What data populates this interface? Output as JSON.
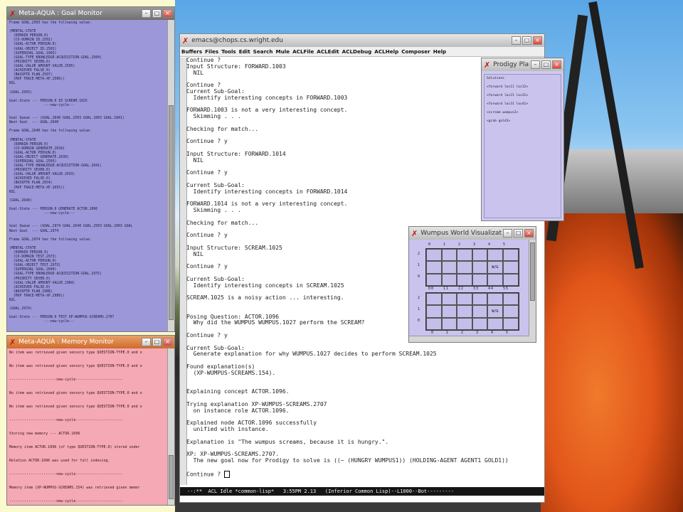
{
  "goal_monitor": {
    "title": "Meta-AQUA : Goal Monitor",
    "lines": [
      "Frame GOAL.2503 has the following value:",
      "",
      "(MENTAL-STATE",
      "  (DOMAIN PERSON.0)",
      "  (CO-DOMAIN ID.2502)",
      "  (GOAL-ACTOR PERSON.0)",
      "  (GOAL-OBJECT ID.2502)",
      "  (SUPERGOAL GOAL.1003)",
      "  (GOAL-TYPE KNOWLEDGE-ACQUISITION-GOAL.2504)",
      "  (PRIORITY SEVEN.0)",
      "  (GOAL-VALUE AMOUNT-VALUE.2505)",
      "  (ACHIEVED FALSE.0)",
      "  (BACKPTR PLAN.2507)",
      "  (MXP TRACE-META-XP.2506))",
      "NIL",
      "",
      "(GOAL.2503)",
      "",
      "Goal-State --- PERSON.0 ID SCREAM.1025",
      "                 ---new-cycle---",
      "",
      "",
      "Goal Queue --- (GOAL.2640 GOAL.2503 GOAL.1003 GOAL.1841)",
      "Next Goal  --- GOAL.2640",
      "",
      "Frame GOAL.2640 has the following value:",
      "",
      "(MENTAL-STATE",
      "  (DOMAIN PERSON.0)",
      "  (CO-DOMAIN GENERATE.2639)",
      "  (GOAL-ACTOR PERSON.0)",
      "  (GOAL-OBJECT GENERATE.2639)",
      "  (SUPERGOAL GOAL.2503)",
      "  (GOAL-TYPE KNOWLEDGE-ACQUISITION-GOAL.2641)",
      "  (PRIORITY SEVEN.0)",
      "  (GOAL-VALUE AMOUNT-VALUE.2633)",
      "  (ACHIEVED FALSE.0)",
      "  (BACKPTR PLAN.2654)",
      "  (MXP TRACE-META-XP.2655))",
      "NIL",
      "",
      "(GOAL.2640)",
      "",
      "Goal-State --- PERSON.0 GENERATE ACTOR.1096",
      "                 ---new-cycle---",
      "",
      "",
      "Goal Queue --- (GOAL.2974 GOAL.2640 GOAL.2503 GOAL.1003 GOAL",
      "Next Goal  --- GOAL.2974",
      "",
      "Frame GOAL.2974 has the following value:",
      "",
      "(MENTAL-STATE",
      "  (DOMAIN PERSON.0)",
      "  (CO-DOMAIN TEST.2973)",
      "  (GOAL-ACTOR PERSON.0)",
      "  (GOAL-OBJECT TEST.2973)",
      "  (SUPERGOAL GOAL.2640)",
      "  (GOAL-TYPE KNOWLEDGE-ACQUISITION-GOAL.2975)",
      "  (PRIORITY SEVEN.0)",
      "  (GOAL-VALUE AMOUNT-VALUE.2984)",
      "  (ACHIEVED FALSE.0)",
      "  (BACKPTR PLAN.2988)",
      "  (MXP TRACE-META-XP.2989))",
      "NIL",
      "",
      "(GOAL.2974)",
      "",
      "Goal-State --- PERSON.0 TEST XP-WUMPUS-SCREAMS.2707",
      "                 ---new-cycle---"
    ]
  },
  "memory_monitor": {
    "title": "Meta-AQUA : Memory Monitor",
    "lines": [
      "No item was retrieved given sensory type QUESTION-TYPE.0 and o",
      "No item was retrieved given sensory type QUESTION-TYPE.0 and o",
      "----------------------new-cycle----------------------",
      "No item was retrieved given sensory type QUESTION-TYPE.0 and o",
      "No item was retrieved given sensory type QUESTION-TYPE.0 and o",
      "----------------------new-cycle----------------------",
      "Storing new memory --- ACTOR.1096",
      "Memory item ACTOR.1096 (of type QUESTION-TYPE.0) stored under",
      "Relation ACTOR.1096 was used for full indexing.",
      "----------------------new-cycle----------------------",
      "Memory item (XP-WUMPUS-SCREAMS.154) was retrieved given memor",
      "----------------------new-cycle----------------------"
    ]
  },
  "emacs": {
    "title": "emacs@chops.cs.wright.edu",
    "menu": [
      "Buffers",
      "Files",
      "Tools",
      "Edit",
      "Search",
      "Mule",
      "ACLFile",
      "ACLEdit",
      "ACLDebug",
      "ACLHelp",
      "Composer",
      "Help"
    ],
    "lines": [
      "Continue ?",
      "Input Structure: FORWARD.1003",
      "  NIL",
      "",
      "Continue ?",
      "Current Sub-Goal:",
      "  Identify interesting concepts in FORWARD.1003",
      "",
      "FORWARD.1003 is not a very interesting concept.",
      "  Skimming . . .",
      "",
      "Checking for match...",
      "",
      "Continue ? y",
      "",
      "Input Structure: FORWARD.1014",
      "  NIL",
      "",
      "Continue ? y",
      "",
      "Current Sub-Goal:",
      "  Identify interesting concepts in FORWARD.1014",
      "",
      "FORWARD.1014 is not a very interesting concept.",
      "  Skimming . . .",
      "",
      "Checking for match...",
      "",
      "Continue ? y",
      "",
      "Input Structure: SCREAM.1025",
      "  NIL",
      "",
      "Continue ? y",
      "",
      "Current Sub-Goal:",
      "  Identify interesting concepts in SCREAM.1025",
      "",
      "SCREAM.1025 is a noisy action ... interesting.",
      "",
      "",
      "Posing Question: ACTOR.1096",
      "  Why did the WUMPUS WUMPUS.1027 perform the SCREAM?",
      "",
      "Continue ? y",
      "",
      "Current Sub-Goal:",
      "  Generate explanation for why WUMPUS.1027 decides to perform SCREAM.1025",
      "",
      "Found explanation(s)",
      "  (XP-WUMPUS-SCREAMS.154).",
      "",
      "",
      "Explaining concept ACTOR.1096.",
      "",
      "Trying explanation XP-WUMPUS-SCREAMS.2707",
      "  on instance role ACTOR.1096.",
      "",
      "Explained node ACTOR.1096 successfully",
      "  unified with instance.",
      "",
      "Explanation is \"The wumpus screams, because it is hungry.\".",
      "",
      "XP: XP-WUMPUS-SCREAMS.2707.",
      "  The new goal now for Prodigy to solve is ((~ (HUNGRY WUMPUS1)) (HOLDING-AGENT AGENT1 GOLD1))",
      "",
      "Continue ? "
    ],
    "modeline": "--:**  ACL Idle *common-lisp*   3:55PM 2.13   (Inferior Common Lisp)--L1000--Bot---------"
  },
  "prodigy": {
    "title": "Prodigy Plan",
    "items": [
      "Solutions",
      "<forward loc11 loc12>",
      "<forward loc21 loc31>",
      "<forward loc31 loc41>",
      "<scream wumpus2>",
      "<grab gold1>"
    ]
  },
  "wumpus": {
    "title": "Wumpus World Visualization",
    "cols": [
      "0",
      "1",
      "2",
      "3",
      "4",
      "5"
    ],
    "rows": [
      "2",
      "1",
      "0"
    ],
    "cell_label": "W/G"
  }
}
